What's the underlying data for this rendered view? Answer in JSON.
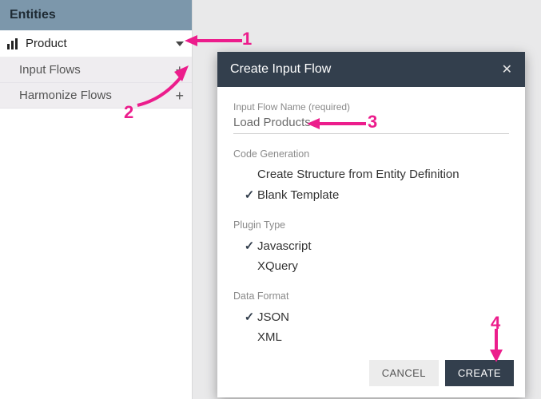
{
  "sidebar": {
    "title": "Entities",
    "entity": {
      "label": "Product"
    },
    "flows": [
      {
        "label": "Input Flows"
      },
      {
        "label": "Harmonize Flows"
      }
    ]
  },
  "dialog": {
    "title": "Create Input Flow",
    "fieldLabel": "Input Flow Name (required)",
    "fieldValue": "Load Products",
    "sections": {
      "codeGeneration": {
        "label": "Code Generation",
        "options": [
          {
            "label": "Create Structure from Entity Definition",
            "checked": false
          },
          {
            "label": "Blank Template",
            "checked": true
          }
        ]
      },
      "pluginType": {
        "label": "Plugin Type",
        "options": [
          {
            "label": "Javascript",
            "checked": true
          },
          {
            "label": "XQuery",
            "checked": false
          }
        ]
      },
      "dataFormat": {
        "label": "Data Format",
        "options": [
          {
            "label": "JSON",
            "checked": true
          },
          {
            "label": "XML",
            "checked": false
          }
        ]
      }
    },
    "buttons": {
      "cancel": "CANCEL",
      "create": "CREATE"
    }
  },
  "annotations": {
    "n1": "1",
    "n2": "2",
    "n3": "3",
    "n4": "4"
  },
  "colors": {
    "accent": "#ec1d8c",
    "dialogHeader": "#333f4d",
    "sidebarHeader": "#7c97ab"
  }
}
